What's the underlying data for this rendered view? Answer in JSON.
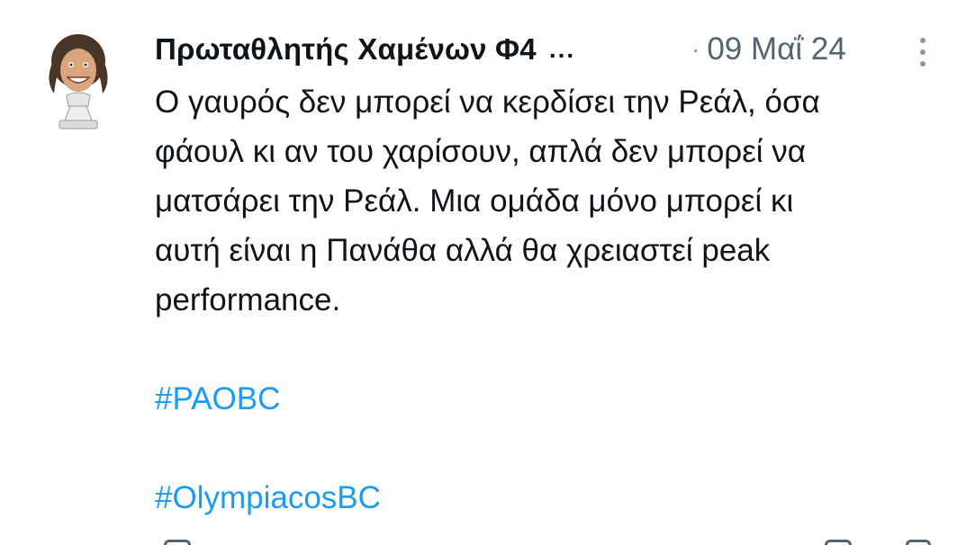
{
  "tweet": {
    "author": {
      "display_name": "Πρωταθλητής Χαμένων Φ4",
      "truncation": "...",
      "avatar_icon": "caricature-avatar-icon"
    },
    "meta": {
      "separator": "·",
      "date": "09 Μαΐ 24"
    },
    "more_icon": "more-vertical-icon",
    "text_lines": [
      "Ο γαυρός δεν μπορεί να κερδίσει την Ρεάλ, όσα",
      "φάουλ κι αν του χαρίσουν, απλά δεν μπορεί να",
      "ματσάρει την Ρεάλ. Μια ομάδα μόνο μπορεί κι",
      "αυτή είναι η Πανάθα αλλά θα χρειαστεί peak",
      "performance."
    ],
    "hashtags": [
      "#PAOBC",
      "#OlympiacosBC"
    ]
  },
  "colors": {
    "text": "#0f1419",
    "secondary": "#536471",
    "link": "#1d9bf0",
    "background": "#ffffff"
  }
}
